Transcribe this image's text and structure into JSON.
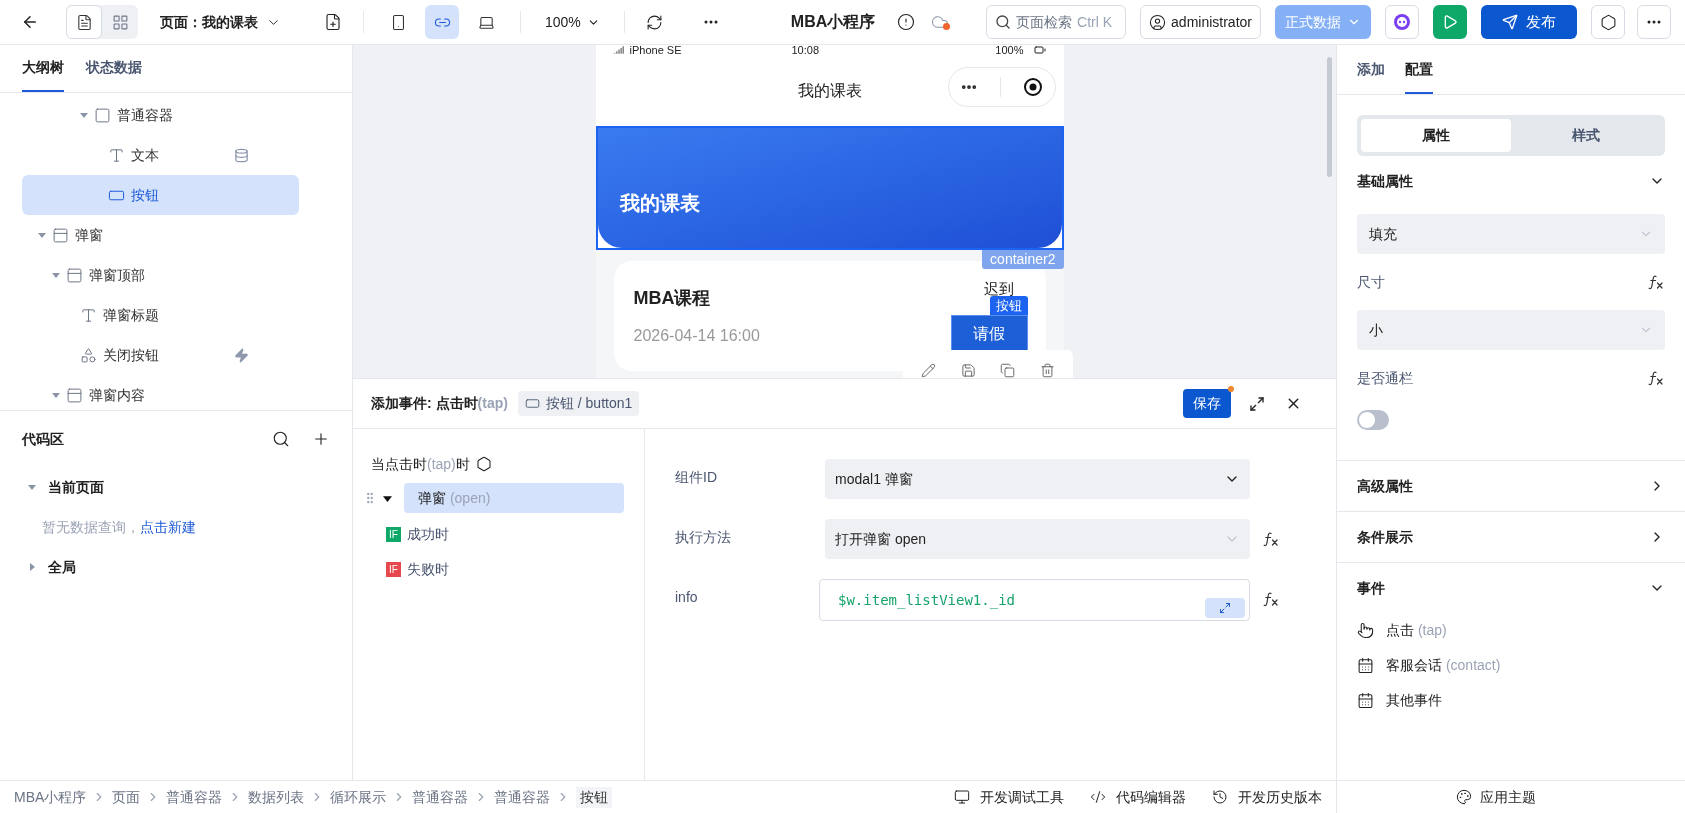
{
  "toolbar": {
    "views": [
      {
        "kind": "outline",
        "selected": true
      },
      {
        "kind": "layout",
        "selected": false
      }
    ],
    "page_selector": "页面：我的课表",
    "devices": [
      {
        "kind": "phone",
        "selected": false
      },
      {
        "kind": "miniprogram",
        "selected": true
      },
      {
        "kind": "desktop",
        "selected": false
      }
    ],
    "zoom": "100%",
    "app_title": "MBA小程序",
    "search": {
      "placeholder": "页面检索",
      "shortcut": "Ctrl K"
    },
    "user": "administrator",
    "environment": {
      "label": "正式数据",
      "disabled": true
    },
    "publish": "发布"
  },
  "left_panel": {
    "tabs": [
      {
        "label": "大纲树",
        "selected": true
      },
      {
        "label": "状态数据",
        "selected": false
      }
    ],
    "tree": [
      {
        "children": [
          {
            "children": [
              {
                "children": [
                  {
                    "label": "普通容器",
                    "kind": "container",
                    "expanded": true,
                    "selected": false,
                    "children": [
                      {
                        "label": "文本",
                        "kind": "text",
                        "data_bound": true,
                        "selected": false
                      },
                      {
                        "label": "按钮",
                        "kind": "button",
                        "selected": true
                      }
                    ]
                  }
                ]
              }
            ]
          }
        ]
      },
      {
        "label": "弹窗",
        "kind": "modal",
        "expanded": true,
        "selected": false,
        "children": [
          {
            "label": "弹窗顶部",
            "kind": "modal",
            "expanded": true,
            "selected": false,
            "children": [
              {
                "label": "弹窗标题",
                "kind": "text",
                "selected": false
              },
              {
                "label": "关闭按钮",
                "kind": "shapes",
                "has_event": true,
                "selected": false
              }
            ]
          },
          {
            "label": "弹窗内容",
            "kind": "modal",
            "expanded": true,
            "selected": false
          }
        ]
      }
    ],
    "code_area": {
      "title": "代码区",
      "groups": [
        {
          "label": "当前页面",
          "expanded": true,
          "empty_text": "暂无数据查询，",
          "link": "点击新建"
        },
        {
          "label": "全局",
          "expanded": false
        }
      ]
    }
  },
  "canvas": {
    "status_bar": {
      "device": "iPhone SE",
      "time": "10:08",
      "battery": "100%"
    },
    "nav_title": "我的课表",
    "header_title": "我的课表",
    "selection_tag": "container2",
    "card": {
      "title": "MBA课程",
      "time": "2026-04-14 16:00",
      "status": "迟到",
      "button": "请假",
      "button_tag": "按钮"
    }
  },
  "event_panel": {
    "title": "添加事件: 点击时",
    "title_note": "(tap)",
    "component_chip": "按钮 / button1",
    "save": "保存",
    "unsaved": true,
    "trigger": {
      "prefix": "当点击时",
      "note": "(tap)",
      "suffix": "时"
    },
    "actions": [
      {
        "label": "弹窗",
        "note": "(open)",
        "selected": true,
        "expanded": true,
        "children": [
          {
            "kind": "success",
            "badge": "IF",
            "label": "成功时"
          },
          {
            "kind": "fail",
            "badge": "IF",
            "label": "失败时"
          }
        ]
      }
    ],
    "form": [
      {
        "kind": "select",
        "label": "组件ID",
        "value": "modal1 弹窗",
        "disabled": false
      },
      {
        "kind": "select",
        "label": "执行方法",
        "value": "打开弹窗 open",
        "disabled": true,
        "formula": true
      },
      {
        "kind": "code",
        "label": "info",
        "value": "$w.item_listView1._id",
        "formula": true
      }
    ]
  },
  "right_panel": {
    "tabs": [
      {
        "label": "添加",
        "selected": false
      },
      {
        "label": "配置",
        "selected": true
      }
    ],
    "segments": [
      {
        "label": "属性",
        "selected": true
      },
      {
        "label": "样式",
        "selected": false
      }
    ],
    "sections": [
      {
        "title": "基础属性",
        "expanded": true,
        "fields": [
          {
            "kind": "select",
            "value": "填充"
          },
          {
            "kind": "select",
            "label": "尺寸",
            "formula": true,
            "value": "小"
          },
          {
            "kind": "switch",
            "label": "是否通栏",
            "formula": true,
            "on": false
          }
        ]
      },
      {
        "title": "高级属性",
        "expanded": false
      },
      {
        "title": "条件展示",
        "expanded": false
      },
      {
        "title": "事件",
        "expanded": true,
        "events": [
          {
            "kind": "tap",
            "label": "点击",
            "note": "(tap)"
          },
          {
            "kind": "contact",
            "label": "客服会话",
            "note": "(contact)"
          },
          {
            "kind": "other",
            "label": "其他事件"
          }
        ]
      }
    ]
  },
  "status_bar": {
    "breadcrumbs": [
      "MBA小程序",
      "页面",
      "普通容器",
      "数据列表",
      "循环展示",
      "普通容器",
      "普通容器",
      "按钮"
    ],
    "tools": [
      {
        "kind": "debug",
        "label": "开发调试工具"
      },
      {
        "kind": "code",
        "label": "代码编辑器"
      },
      {
        "kind": "history",
        "label": "开发历史版本"
      }
    ],
    "theme": "应用主题"
  }
}
